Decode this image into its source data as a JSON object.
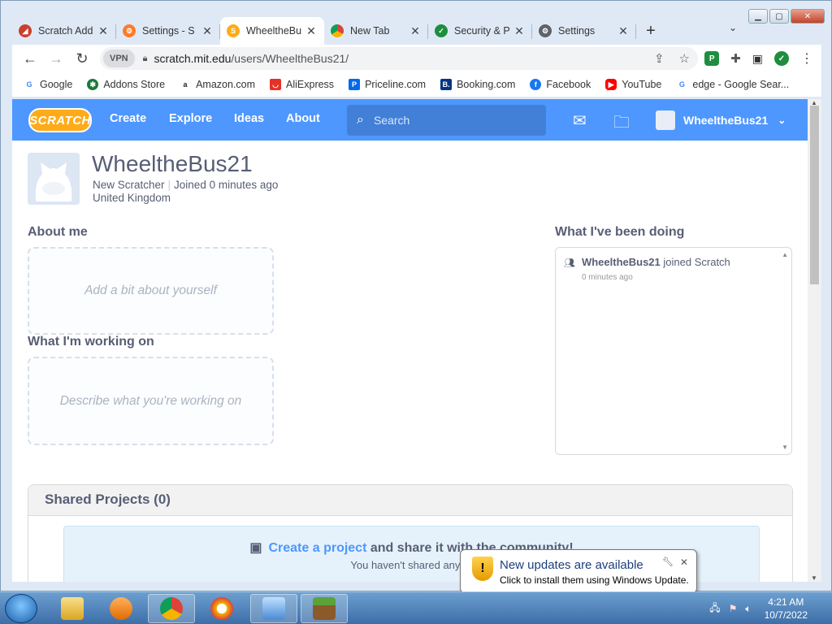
{
  "browser": {
    "tabs": [
      {
        "label": "Scratch Add",
        "fav": "scratch-addons-icon",
        "color": "#cc3e2d",
        "active": false
      },
      {
        "label": "Settings - S",
        "fav": "scratch-addons-settings-icon",
        "color": "#ff7b26",
        "active": false
      },
      {
        "label": "WheeltheBu",
        "fav": "scratch-s-icon",
        "color": "#ffab19",
        "active": true
      },
      {
        "label": "New Tab",
        "fav": "chrome-icon",
        "color": "#4285f4",
        "active": false
      },
      {
        "label": "Security & P",
        "fav": "shield-check-icon",
        "color": "#1e8e3e",
        "active": false
      },
      {
        "label": "Settings",
        "fav": "gear-icon",
        "color": "#5f6368",
        "active": false
      }
    ],
    "url_host": "scratch.mit.edu",
    "url_path": "/users/WheeltheBus21/",
    "vpn_label": "VPN",
    "bookmarks": [
      {
        "label": "Google",
        "icon": "google-icon",
        "color": "#4285f4",
        "glyph": "G"
      },
      {
        "label": "Addons Store",
        "icon": "addons-store-icon",
        "color": "#1b7a3c",
        "glyph": "✱"
      },
      {
        "label": "Amazon.com",
        "icon": "amazon-icon",
        "color": "#222",
        "glyph": "a"
      },
      {
        "label": "AliExpress",
        "icon": "aliexpress-icon",
        "color": "#e43225",
        "glyph": "◡"
      },
      {
        "label": "Priceline.com",
        "icon": "priceline-icon",
        "color": "#0068ef",
        "glyph": "P"
      },
      {
        "label": "Booking.com",
        "icon": "booking-icon",
        "color": "#003580",
        "glyph": "B."
      },
      {
        "label": "Facebook",
        "icon": "facebook-icon",
        "color": "#1877f2",
        "glyph": "f"
      },
      {
        "label": "YouTube",
        "icon": "youtube-icon",
        "color": "#ff0000",
        "glyph": "▶"
      },
      {
        "label": "edge - Google Sear...",
        "icon": "google-icon",
        "color": "#4285f4",
        "glyph": "G"
      }
    ]
  },
  "scratch": {
    "logo": "SCRATCH",
    "nav": [
      "Create",
      "Explore",
      "Ideas",
      "About"
    ],
    "search_placeholder": "Search",
    "username": "WheeltheBus21",
    "profile": {
      "name": "WheeltheBus21",
      "status": "New Scratcher",
      "joined": "Joined 0 minutes ago",
      "country": "United Kingdom"
    },
    "about_title": "About me",
    "about_placeholder": "Add a bit about yourself",
    "working_title": "What I'm working on",
    "working_placeholder": "Describe what you're working on",
    "activity_title": "What I've been doing",
    "activity": {
      "user": "WheeltheBus21",
      "action": "joined Scratch",
      "time": "0 minutes ago"
    },
    "shared_title": "Shared Projects (0)",
    "empty_link": "Create a project",
    "empty_rest": " and share it with the community!",
    "empty_sub": "You haven't shared any pr"
  },
  "notification": {
    "title": "New updates are available",
    "subtitle": "Click to install them using Windows Update."
  },
  "taskbar": {
    "time": "4:21 AM",
    "date": "10/7/2022"
  }
}
